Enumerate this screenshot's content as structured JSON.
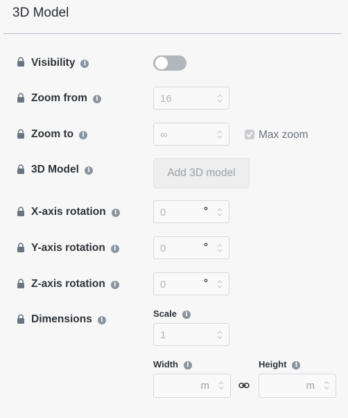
{
  "panel": {
    "title": "3D Model"
  },
  "rows": {
    "visibility": {
      "label": "Visibility",
      "enabled": false
    },
    "zoom_from": {
      "label": "Zoom from",
      "value": "16"
    },
    "zoom_to": {
      "label": "Zoom to",
      "value": "∞",
      "max_zoom_label": "Max zoom",
      "max_zoom_checked": true
    },
    "model": {
      "label": "3D Model",
      "button": "Add 3D model"
    },
    "x_rotation": {
      "label": "X-axis rotation",
      "value": "0",
      "unit": "°"
    },
    "y_rotation": {
      "label": "Y-axis rotation",
      "value": "0",
      "unit": "°"
    },
    "z_rotation": {
      "label": "Z-axis rotation",
      "value": "0",
      "unit": "°"
    },
    "dimensions": {
      "label": "Dimensions",
      "scale_label": "Scale",
      "scale_value": "1",
      "width_label": "Width",
      "width_unit": "m",
      "height_label": "Height",
      "height_unit": "m"
    }
  },
  "info_glyph": "i",
  "colors": {
    "border": "#d6d8db",
    "muted_text": "#b1b4b8",
    "toggle_off": "#b3b6bb"
  }
}
